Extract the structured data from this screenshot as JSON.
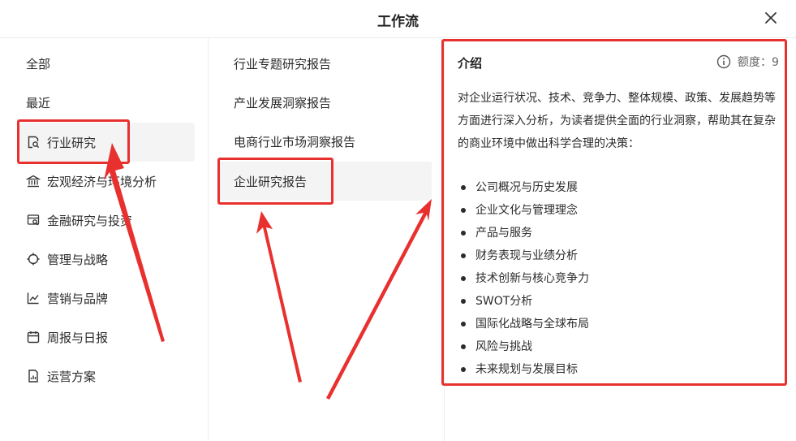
{
  "header": {
    "title": "工作流"
  },
  "nav": {
    "items": [
      {
        "label": "全部",
        "icon": ""
      },
      {
        "label": "最近",
        "icon": ""
      },
      {
        "label": "行业研究",
        "icon": "document-search-icon"
      },
      {
        "label": "宏观经济与环境分析",
        "icon": "bank-icon"
      },
      {
        "label": "金融研究与投资",
        "icon": "finance-search-icon"
      },
      {
        "label": "管理与战略",
        "icon": "target-icon"
      },
      {
        "label": "营销与品牌",
        "icon": "trend-chart-icon"
      },
      {
        "label": "周报与日报",
        "icon": "calendar-icon"
      },
      {
        "label": "运营方案",
        "icon": "report-chart-icon"
      }
    ]
  },
  "reports": {
    "items": [
      {
        "label": "行业专题研究报告"
      },
      {
        "label": "产业发展洞察报告"
      },
      {
        "label": "电商行业市场洞察报告"
      },
      {
        "label": "企业研究报告"
      }
    ]
  },
  "intro": {
    "title": "介绍",
    "quota_label": "额度：9",
    "description": "对企业运行状况、技术、竞争力、整体规模、政策、发展趋势等方面进行深入分析，为读者提供全面的行业洞察，帮助其在复杂的商业环境中做出科学合理的决策：",
    "bullets": [
      "公司概况与历史发展",
      "企业文化与管理理念",
      "产品与服务",
      "财务表现与业绩分析",
      "技术创新与核心竞争力",
      "SWOT分析",
      "国际化战略与全球布局",
      "风险与挑战",
      "未来规划与发展目标"
    ]
  },
  "colors": {
    "annotation": "#e8312f",
    "active_bg": "#f4f4f4"
  }
}
